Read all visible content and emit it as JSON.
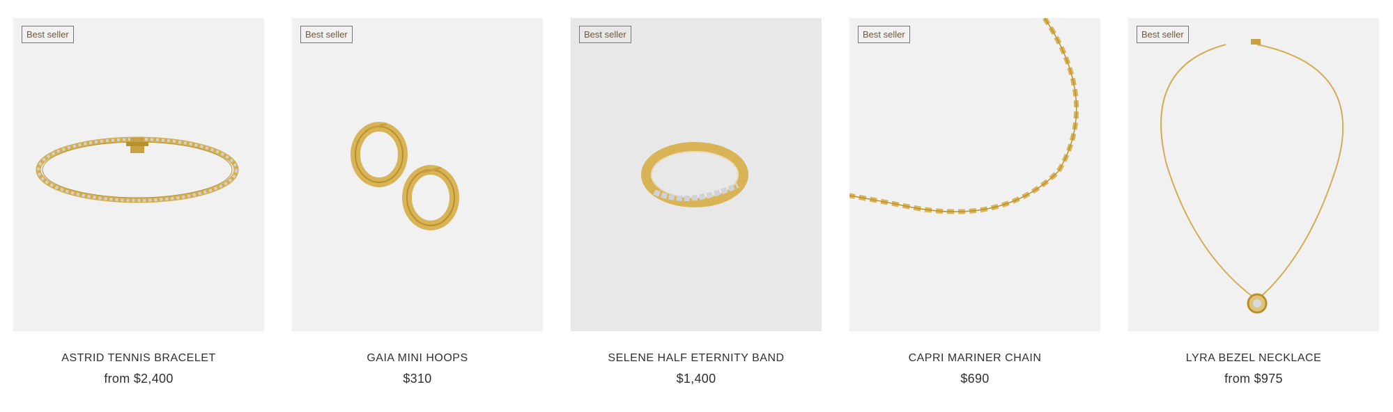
{
  "colors": {
    "gold": "#d9b456",
    "gold_dark": "#b8912e",
    "badge_border": "#8a7346",
    "tile_bg": "#f1f1f1"
  },
  "products": [
    {
      "badge": "Best seller",
      "name": "ASTRID TENNIS BRACELET",
      "price": "from $2,400",
      "image_icon": "tennis-bracelet-image"
    },
    {
      "badge": "Best seller",
      "name": "GAIA MINI HOOPS",
      "price": "$310",
      "image_icon": "hoop-earrings-image"
    },
    {
      "badge": "Best seller",
      "name": "SELENE HALF ETERNITY BAND",
      "price": "$1,400",
      "image_icon": "eternity-ring-image"
    },
    {
      "badge": "Best seller",
      "name": "CAPRI MARINER CHAIN",
      "price": "$690",
      "image_icon": "mariner-chain-image"
    },
    {
      "badge": "Best seller",
      "name": "LYRA BEZEL NECKLACE",
      "price": "from $975",
      "image_icon": "bezel-necklace-image"
    }
  ]
}
